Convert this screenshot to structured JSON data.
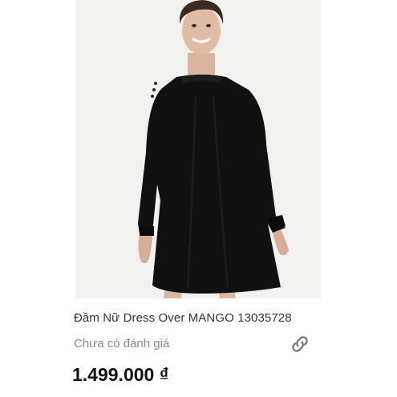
{
  "product": {
    "image_alt": "Black long-sleeve mini dress worn by model",
    "title": "Đầm Nữ Dress Over MANGO 13035728",
    "rating_text": "Chưa có đánh giá",
    "price": "1.499.000 ₫",
    "link_icon": "link-icon"
  },
  "colors": {
    "background": "#ffffff",
    "photo_bg": "#f1f1f0",
    "dress": "#111111",
    "title": "#333333",
    "rating": "#8a8a8a",
    "price": "#111111",
    "icon": "#777777"
  }
}
